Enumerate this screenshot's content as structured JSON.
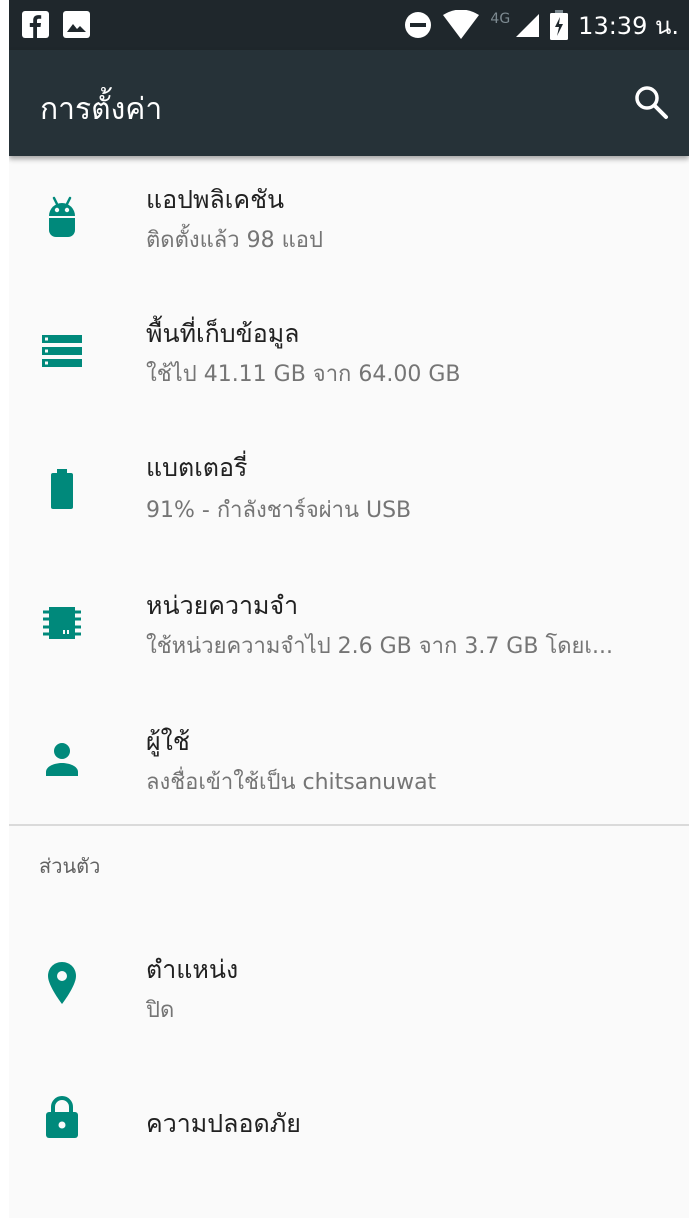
{
  "status_bar": {
    "time": "13:39 น.",
    "network": "4G"
  },
  "toolbar": {
    "title": "การตั้งค่า"
  },
  "settings": [
    {
      "title": "แอปพลิเคชัน",
      "summary": "ติดตั้งแล้ว 98 แอป",
      "icon": "android-icon"
    },
    {
      "title": "พื้นที่เก็บข้อมูล",
      "summary": "ใช้ไป 41.11 GB จาก 64.00 GB",
      "icon": "storage-icon"
    },
    {
      "title": "แบตเตอรี่",
      "summary": "91% - กำลังชาร์จผ่าน USB",
      "icon": "battery-icon"
    },
    {
      "title": "หน่วยความจำ",
      "summary": "ใช้หน่วยความจำไป 2.6 GB จาก 3.7 GB โดยเ...",
      "icon": "memory-icon"
    },
    {
      "title": "ผู้ใช้",
      "summary": "ลงชื่อเข้าใช้เป็น chitsanuwat",
      "icon": "person-icon"
    }
  ],
  "category_personal": "ส่วนตัว",
  "personal": [
    {
      "title": "ตำแหน่ง",
      "summary": "ปิด",
      "icon": "location-icon"
    },
    {
      "title": "ความปลอดภัย",
      "icon": "lock-icon"
    }
  ],
  "colors": {
    "accent": "#00897b",
    "toolbar": "#263238",
    "statusbar": "#1f272c",
    "background": "#fafafa"
  }
}
